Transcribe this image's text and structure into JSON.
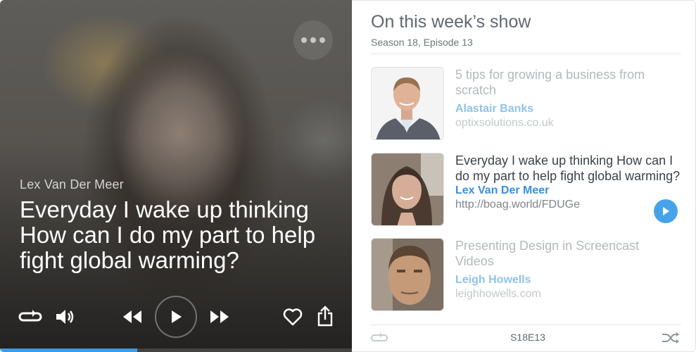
{
  "player": {
    "speaker_name": "Lex Van Der Meer",
    "quote": "Everyday I wake up thinking How can I do my part to help fight global warming?",
    "progress": 0.39,
    "icons": {
      "more": "more-dots-icon",
      "repeat": "repeat-icon",
      "volume": "volume-icon",
      "rewind": "rewind-icon",
      "play": "play-icon",
      "fast_forward": "fast-forward-icon",
      "like": "heart-icon",
      "share": "share-icon"
    },
    "accent_color": "#3f9ae6"
  },
  "panel": {
    "title": "On this week’s show",
    "subtitle": "Season 18, Episode 13",
    "episodes": [
      {
        "title": "5 tips for growing a business from scratch",
        "name": "Alastair Banks",
        "url": "optixsolutions.co.uk",
        "active": false
      },
      {
        "title": "Everyday I wake up thinking How can I do my part to help fight global warming?",
        "name": "Lex Van Der Meer",
        "url": "http://boag.world/FDUGe",
        "active": true
      },
      {
        "title": "Presenting Design in Screencast Videos",
        "name": "Leigh Howells",
        "url": "leighhowells.com",
        "active": false
      }
    ],
    "footer": {
      "episode_code": "S18E13",
      "icons": {
        "left": "repeat-icon",
        "right": "shuffle-icon"
      }
    },
    "link_color": "#3a8fd9",
    "play_button_color": "#46a3ea"
  }
}
